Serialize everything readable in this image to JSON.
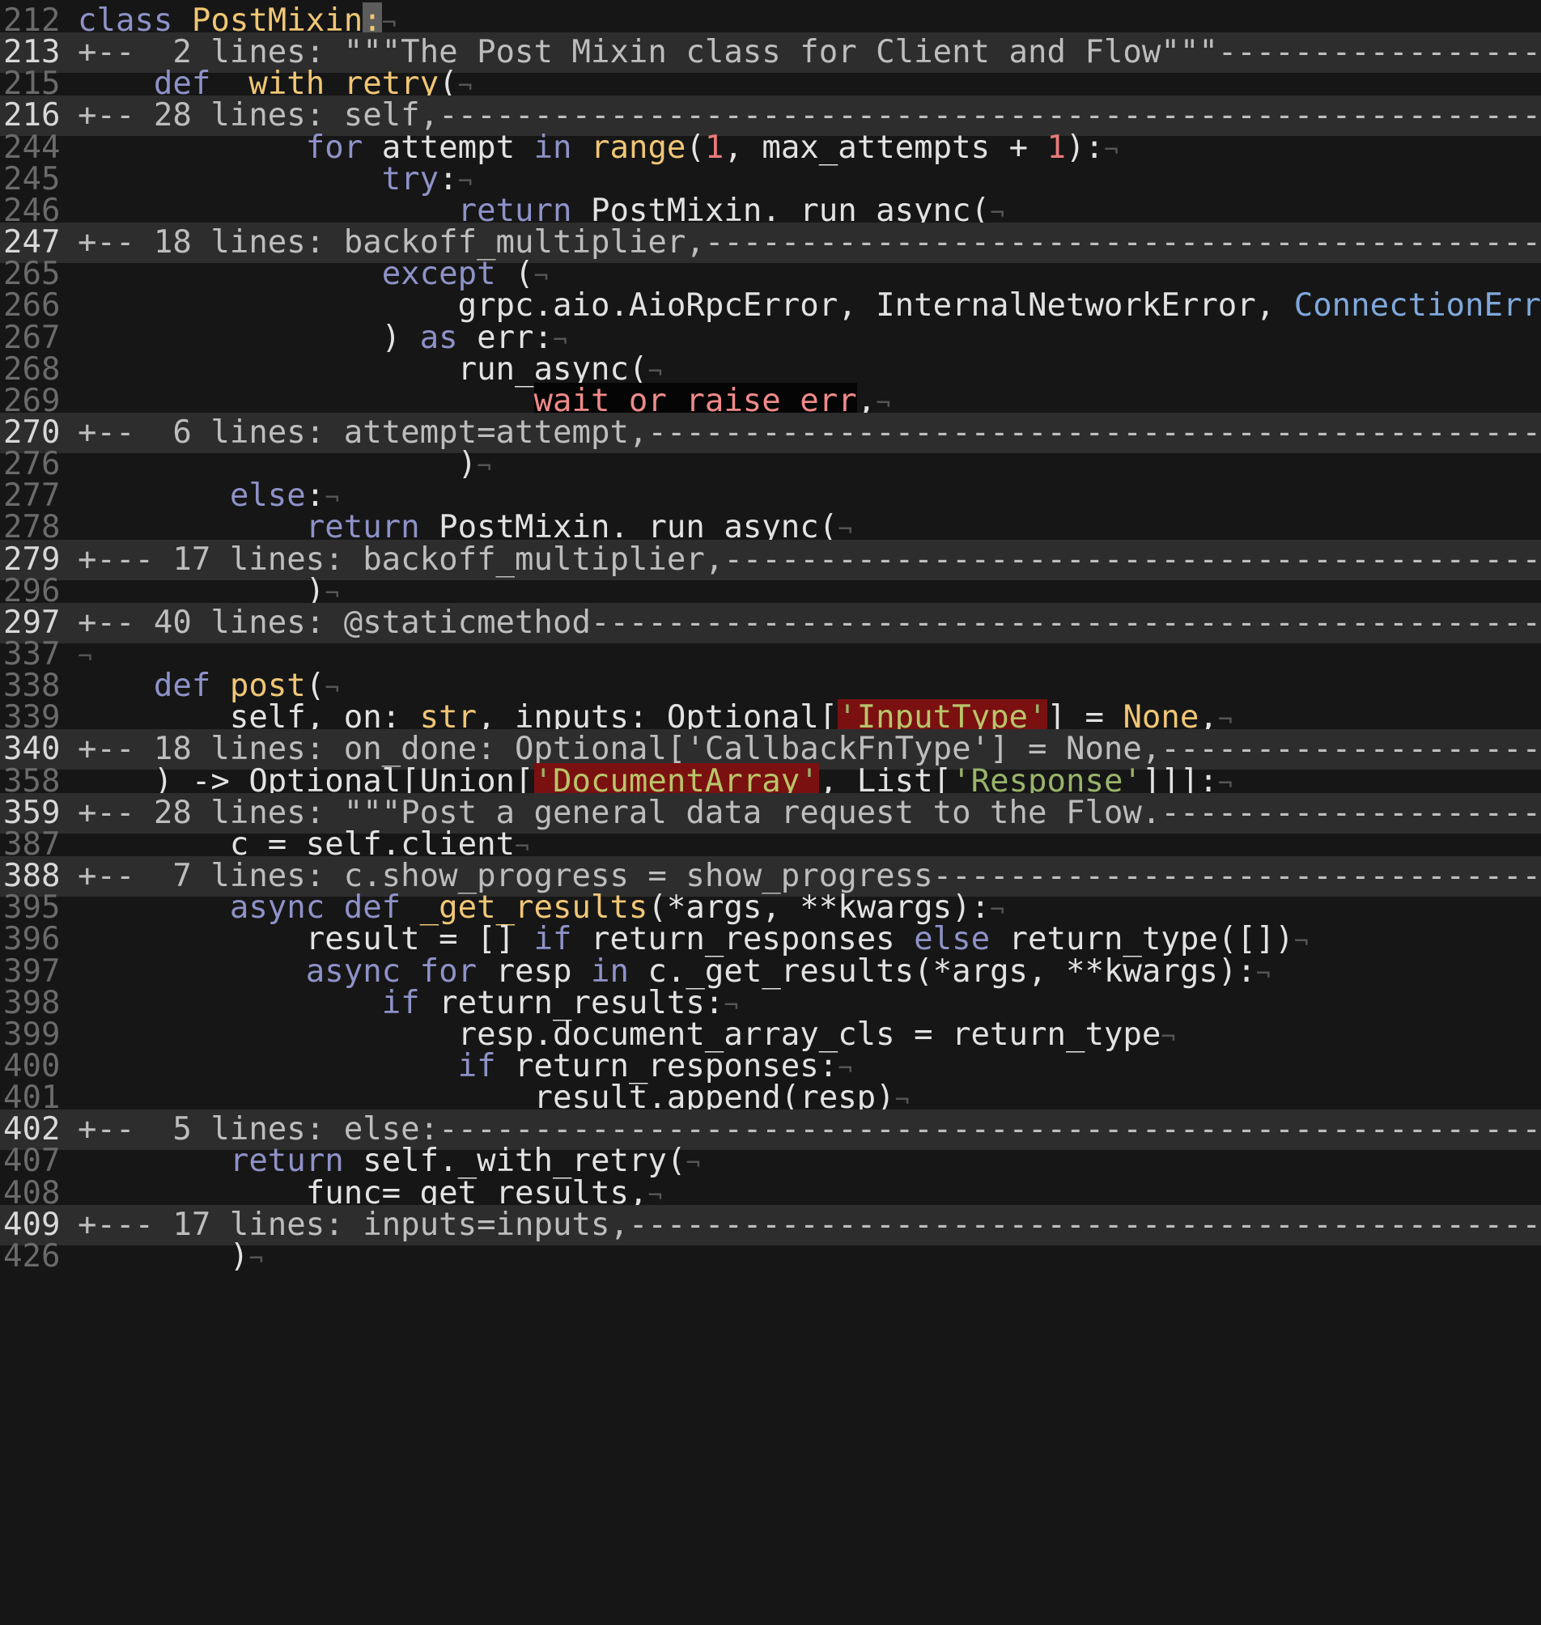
{
  "editor": {
    "lines": [
      {
        "n": "212",
        "fold": false,
        "tokens": [
          [
            "kw",
            "class"
          ],
          [
            "p",
            " "
          ],
          [
            "fn",
            "PostMixin"
          ],
          [
            "cursor",
            ":"
          ],
          [
            "nl",
            "¬"
          ]
        ]
      },
      {
        "n": "213",
        "fold": true,
        "tokens": [
          [
            "p",
            "+--  2 lines: \"\"\"The Post Mixin class for Client and Flow\"\"\"----------------------------------------------------------"
          ]
        ]
      },
      {
        "n": "215",
        "fold": false,
        "tokens": [
          [
            "p",
            "    "
          ],
          [
            "kw",
            "def"
          ],
          [
            "p",
            " "
          ],
          [
            "fn",
            "_with_retry"
          ],
          [
            "p",
            "("
          ],
          [
            "nl",
            "¬"
          ]
        ]
      },
      {
        "n": "216",
        "fold": true,
        "tokens": [
          [
            "p",
            "+-- 28 lines: self,-----------------------------------------------------------------------------------------------------"
          ]
        ]
      },
      {
        "n": "244",
        "fold": false,
        "tokens": [
          [
            "p",
            "            "
          ],
          [
            "kw",
            "for"
          ],
          [
            "p",
            " attempt "
          ],
          [
            "kw",
            "in"
          ],
          [
            "p",
            " "
          ],
          [
            "fn",
            "range"
          ],
          [
            "p",
            "("
          ],
          [
            "num",
            "1"
          ],
          [
            "p",
            ", max_attempts + "
          ],
          [
            "num",
            "1"
          ],
          [
            "p",
            "):"
          ],
          [
            "nl",
            "¬"
          ]
        ]
      },
      {
        "n": "245",
        "fold": false,
        "tokens": [
          [
            "p",
            "                "
          ],
          [
            "kw",
            "try"
          ],
          [
            "p",
            ":"
          ],
          [
            "nl",
            "¬"
          ]
        ]
      },
      {
        "n": "246",
        "fold": false,
        "tokens": [
          [
            "p",
            "                    "
          ],
          [
            "kw",
            "return"
          ],
          [
            "p",
            " PostMixin._run_async("
          ],
          [
            "nl",
            "¬"
          ]
        ]
      },
      {
        "n": "247",
        "fold": true,
        "tokens": [
          [
            "p",
            "+-- 18 lines: backoff_multiplier,----------------------------------------------------------------------------------------"
          ]
        ]
      },
      {
        "n": "265",
        "fold": false,
        "tokens": [
          [
            "p",
            "                "
          ],
          [
            "kw",
            "except"
          ],
          [
            "p",
            " ("
          ],
          [
            "nl",
            "¬"
          ]
        ]
      },
      {
        "n": "266",
        "fold": false,
        "tokens": [
          [
            "p",
            "                    grpc.aio.AioRpcError, InternalNetworkError, "
          ],
          [
            "bi",
            "ConnectionError"
          ],
          [
            "p",
            ","
          ],
          [
            "nl",
            "¬"
          ]
        ]
      },
      {
        "n": "267",
        "fold": false,
        "tokens": [
          [
            "p",
            "                ) "
          ],
          [
            "kw",
            "as"
          ],
          [
            "p",
            " err:"
          ],
          [
            "nl",
            "¬"
          ]
        ]
      },
      {
        "n": "268",
        "fold": false,
        "tokens": [
          [
            "p",
            "                    run_async("
          ],
          [
            "nl",
            "¬"
          ]
        ]
      },
      {
        "n": "269",
        "fold": false,
        "tokens": [
          [
            "p",
            "                        "
          ],
          [
            "err",
            "wait_or_raise_err"
          ],
          [
            "p",
            ","
          ],
          [
            "nl",
            "¬"
          ]
        ]
      },
      {
        "n": "270",
        "fold": true,
        "tokens": [
          [
            "p",
            "+--  6 lines: attempt=attempt,-------------------------------------------------------------------------------------------"
          ]
        ]
      },
      {
        "n": "276",
        "fold": false,
        "tokens": [
          [
            "p",
            "                    )"
          ],
          [
            "nl",
            "¬"
          ]
        ]
      },
      {
        "n": "277",
        "fold": false,
        "tokens": [
          [
            "p",
            "        "
          ],
          [
            "kw",
            "else"
          ],
          [
            "p",
            ":"
          ],
          [
            "nl",
            "¬"
          ]
        ]
      },
      {
        "n": "278",
        "fold": false,
        "tokens": [
          [
            "p",
            "            "
          ],
          [
            "kw",
            "return"
          ],
          [
            "p",
            " PostMixin._run_async("
          ],
          [
            "nl",
            "¬"
          ]
        ]
      },
      {
        "n": "279",
        "fold": true,
        "tokens": [
          [
            "p",
            "+--- 17 lines: backoff_multiplier,---------------------------------------------------------------------------------------"
          ]
        ]
      },
      {
        "n": "296",
        "fold": false,
        "tokens": [
          [
            "p",
            "            )"
          ],
          [
            "nl",
            "¬"
          ]
        ]
      },
      {
        "n": "297",
        "fold": true,
        "tokens": [
          [
            "p",
            "+-- 40 lines: @staticmethod----------------------------------------------------------------------------------------------"
          ]
        ]
      },
      {
        "n": "337",
        "fold": false,
        "tokens": [
          [
            "nl",
            "¬"
          ]
        ]
      },
      {
        "n": "338",
        "fold": false,
        "tokens": [
          [
            "p",
            "    "
          ],
          [
            "kw",
            "def"
          ],
          [
            "p",
            " "
          ],
          [
            "fn",
            "post"
          ],
          [
            "p",
            "("
          ],
          [
            "nl",
            "¬"
          ]
        ]
      },
      {
        "n": "339",
        "fold": false,
        "tokens": [
          [
            "p",
            "        self, on: "
          ],
          [
            "fn",
            "str"
          ],
          [
            "p",
            ", inputs: Optional["
          ],
          [
            "hlq",
            "'"
          ],
          [
            "hlu",
            "InputType"
          ],
          [
            "hlq",
            "'"
          ],
          [
            "p",
            "] = "
          ],
          [
            "fn",
            "None"
          ],
          [
            "p",
            ","
          ],
          [
            "nl",
            "¬"
          ]
        ]
      },
      {
        "n": "340",
        "fold": true,
        "tokens": [
          [
            "p",
            "+-- 18 lines: on_done: Optional['CallbackFnType'] = None,---------------------------------------------------------------"
          ]
        ]
      },
      {
        "n": "358",
        "fold": false,
        "tokens": [
          [
            "p",
            "    ) -> Optional[Union["
          ],
          [
            "hlq",
            "'"
          ],
          [
            "hlu",
            "DocumentArray"
          ],
          [
            "hlq",
            "'"
          ],
          [
            "p",
            ", List["
          ],
          [
            "str",
            "'Response'"
          ],
          [
            "p",
            "]]]:"
          ],
          [
            "nl",
            "¬"
          ]
        ]
      },
      {
        "n": "359",
        "fold": true,
        "tokens": [
          [
            "p",
            "+-- 28 lines: \"\"\"Post a general data request to the Flow.-------------------------------------------------------------"
          ]
        ]
      },
      {
        "n": "387",
        "fold": false,
        "tokens": [
          [
            "p",
            "        c = self.client"
          ],
          [
            "nl",
            "¬"
          ]
        ]
      },
      {
        "n": "388",
        "fold": true,
        "tokens": [
          [
            "p",
            "+--  7 lines: c.show_progress = show_progress---------------------------------------------------------------------------"
          ]
        ]
      },
      {
        "n": "395",
        "fold": false,
        "tokens": [
          [
            "p",
            "        "
          ],
          [
            "kw",
            "async def"
          ],
          [
            "p",
            " "
          ],
          [
            "fn",
            "_get_results"
          ],
          [
            "p",
            "(*args, **kwargs):"
          ],
          [
            "nl",
            "¬"
          ]
        ]
      },
      {
        "n": "396",
        "fold": false,
        "tokens": [
          [
            "p",
            "            result = [] "
          ],
          [
            "kw",
            "if"
          ],
          [
            "p",
            " return_responses "
          ],
          [
            "kw",
            "else"
          ],
          [
            "p",
            " return_type([])"
          ],
          [
            "nl",
            "¬"
          ]
        ]
      },
      {
        "n": "397",
        "fold": false,
        "tokens": [
          [
            "p",
            "            "
          ],
          [
            "kw",
            "async for"
          ],
          [
            "p",
            " resp "
          ],
          [
            "kw",
            "in"
          ],
          [
            "p",
            " c._get_results(*args, **kwargs):"
          ],
          [
            "nl",
            "¬"
          ]
        ]
      },
      {
        "n": "398",
        "fold": false,
        "tokens": [
          [
            "p",
            "                "
          ],
          [
            "kw",
            "if"
          ],
          [
            "p",
            " return_results:"
          ],
          [
            "nl",
            "¬"
          ]
        ]
      },
      {
        "n": "399",
        "fold": false,
        "tokens": [
          [
            "p",
            "                    resp.document_array_cls = return_type"
          ],
          [
            "nl",
            "¬"
          ]
        ]
      },
      {
        "n": "400",
        "fold": false,
        "tokens": [
          [
            "p",
            "                    "
          ],
          [
            "kw",
            "if"
          ],
          [
            "p",
            " return_responses:"
          ],
          [
            "nl",
            "¬"
          ]
        ]
      },
      {
        "n": "401",
        "fold": false,
        "tokens": [
          [
            "p",
            "                        result.append(resp)"
          ],
          [
            "nl",
            "¬"
          ]
        ]
      },
      {
        "n": "402",
        "fold": true,
        "tokens": [
          [
            "p",
            "+--  5 lines: else:----------------------------------------------------------------------------------------------------"
          ]
        ]
      },
      {
        "n": "407",
        "fold": false,
        "tokens": [
          [
            "p",
            "        "
          ],
          [
            "kw",
            "return"
          ],
          [
            "p",
            " self._with_retry("
          ],
          [
            "nl",
            "¬"
          ]
        ]
      },
      {
        "n": "408",
        "fold": false,
        "tokens": [
          [
            "p",
            "            func=_get_results,"
          ],
          [
            "nl",
            "¬"
          ]
        ]
      },
      {
        "n": "409",
        "fold": true,
        "tokens": [
          [
            "p",
            "+--- 17 lines: inputs=inputs,--------------------------------------------------------------------------------------------"
          ]
        ]
      },
      {
        "n": "426",
        "fold": false,
        "tokens": [
          [
            "p",
            "        )"
          ],
          [
            "nl",
            "¬"
          ]
        ]
      }
    ]
  }
}
